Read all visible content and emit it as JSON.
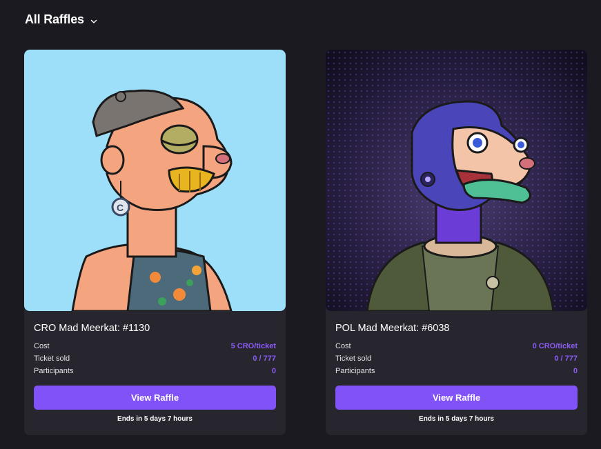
{
  "header": {
    "title": "All Raffles"
  },
  "raffles": [
    {
      "title": "CRO Mad Meerkat: #1130",
      "cost_label": "Cost",
      "cost_value": "5 CRO/ticket",
      "sold_label": "Ticket sold",
      "sold_value": "0 / 777",
      "participants_label": "Participants",
      "participants_value": "0",
      "button_label": "View Raffle",
      "ends_text": "Ends in 5 days 7 hours",
      "background_color": "#9ddff9"
    },
    {
      "title": "POL Mad Meerkat: #6038",
      "cost_label": "Cost",
      "cost_value": "0 CRO/ticket",
      "sold_label": "Ticket sold",
      "sold_value": "0 / 777",
      "participants_label": "Participants",
      "participants_value": "0",
      "button_label": "View Raffle",
      "ends_text": "Ends in 5 days 7 hours",
      "background_color": "#1d1630"
    }
  ],
  "colors": {
    "page_bg": "#1c1a21",
    "card_bg": "#27252d",
    "accent": "#8052f7",
    "value_text": "#8b5cf6"
  }
}
